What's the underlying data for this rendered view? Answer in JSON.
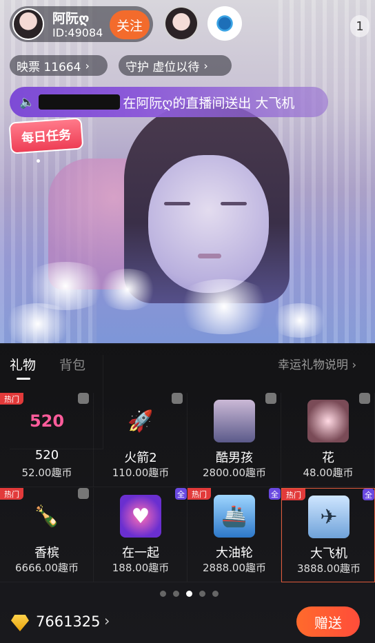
{
  "header": {
    "anchor_name": "阿阮ღ",
    "anchor_id": "ID:49084",
    "follow_label": "关注",
    "viewer_count": "1"
  },
  "stats": {
    "tickets_label": "映票 11664",
    "guard_label": "守护 虚位以待"
  },
  "broadcast": {
    "suffix_text": "在阿阮ღ的直播间送出 大飞机"
  },
  "task_badge": "每日任务",
  "tabs": {
    "gift": "礼物",
    "bag": "背包"
  },
  "lucky_link": "幸运礼物说明",
  "gifts": [
    {
      "name": "520",
      "price": "52.00趣币",
      "hot": "热门",
      "badge": "",
      "icon": "520-hearts-icon",
      "sel": false
    },
    {
      "name": "火箭2",
      "price": "110.00趣币",
      "hot": "",
      "badge": "",
      "icon": "rocket-icon",
      "sel": false
    },
    {
      "name": "酷男孩",
      "price": "2800.00趣币",
      "hot": "",
      "badge": "",
      "icon": "cool-boy-icon",
      "sel": false
    },
    {
      "name": "花",
      "price": "48.00趣币",
      "hot": "",
      "badge": "",
      "icon": "flower-firework-icon",
      "sel": false
    },
    {
      "name": "香槟",
      "price": "6666.00趣币",
      "hot": "热门",
      "badge": "",
      "icon": "champagne-icon",
      "sel": false
    },
    {
      "name": "在一起",
      "price": "188.00趣币",
      "hot": "",
      "badge": "全",
      "icon": "hearts-together-icon",
      "sel": false
    },
    {
      "name": "大油轮",
      "price": "2888.00趣币",
      "hot": "热门",
      "badge": "全",
      "icon": "cruise-ship-icon",
      "sel": false
    },
    {
      "name": "大飞机",
      "price": "3888.00趣币",
      "hot": "热门",
      "badge": "全",
      "icon": "airplane-icon",
      "sel": true
    }
  ],
  "pager": {
    "pages": 5,
    "current": 3
  },
  "footer": {
    "balance": "7661325",
    "send_label": "赠送"
  },
  "colors": {
    "accent": "#f36b2c",
    "hot_tag": "#e23a3a",
    "quan_tag": "#6a49e0",
    "broadcast": "#7d4bd6"
  }
}
